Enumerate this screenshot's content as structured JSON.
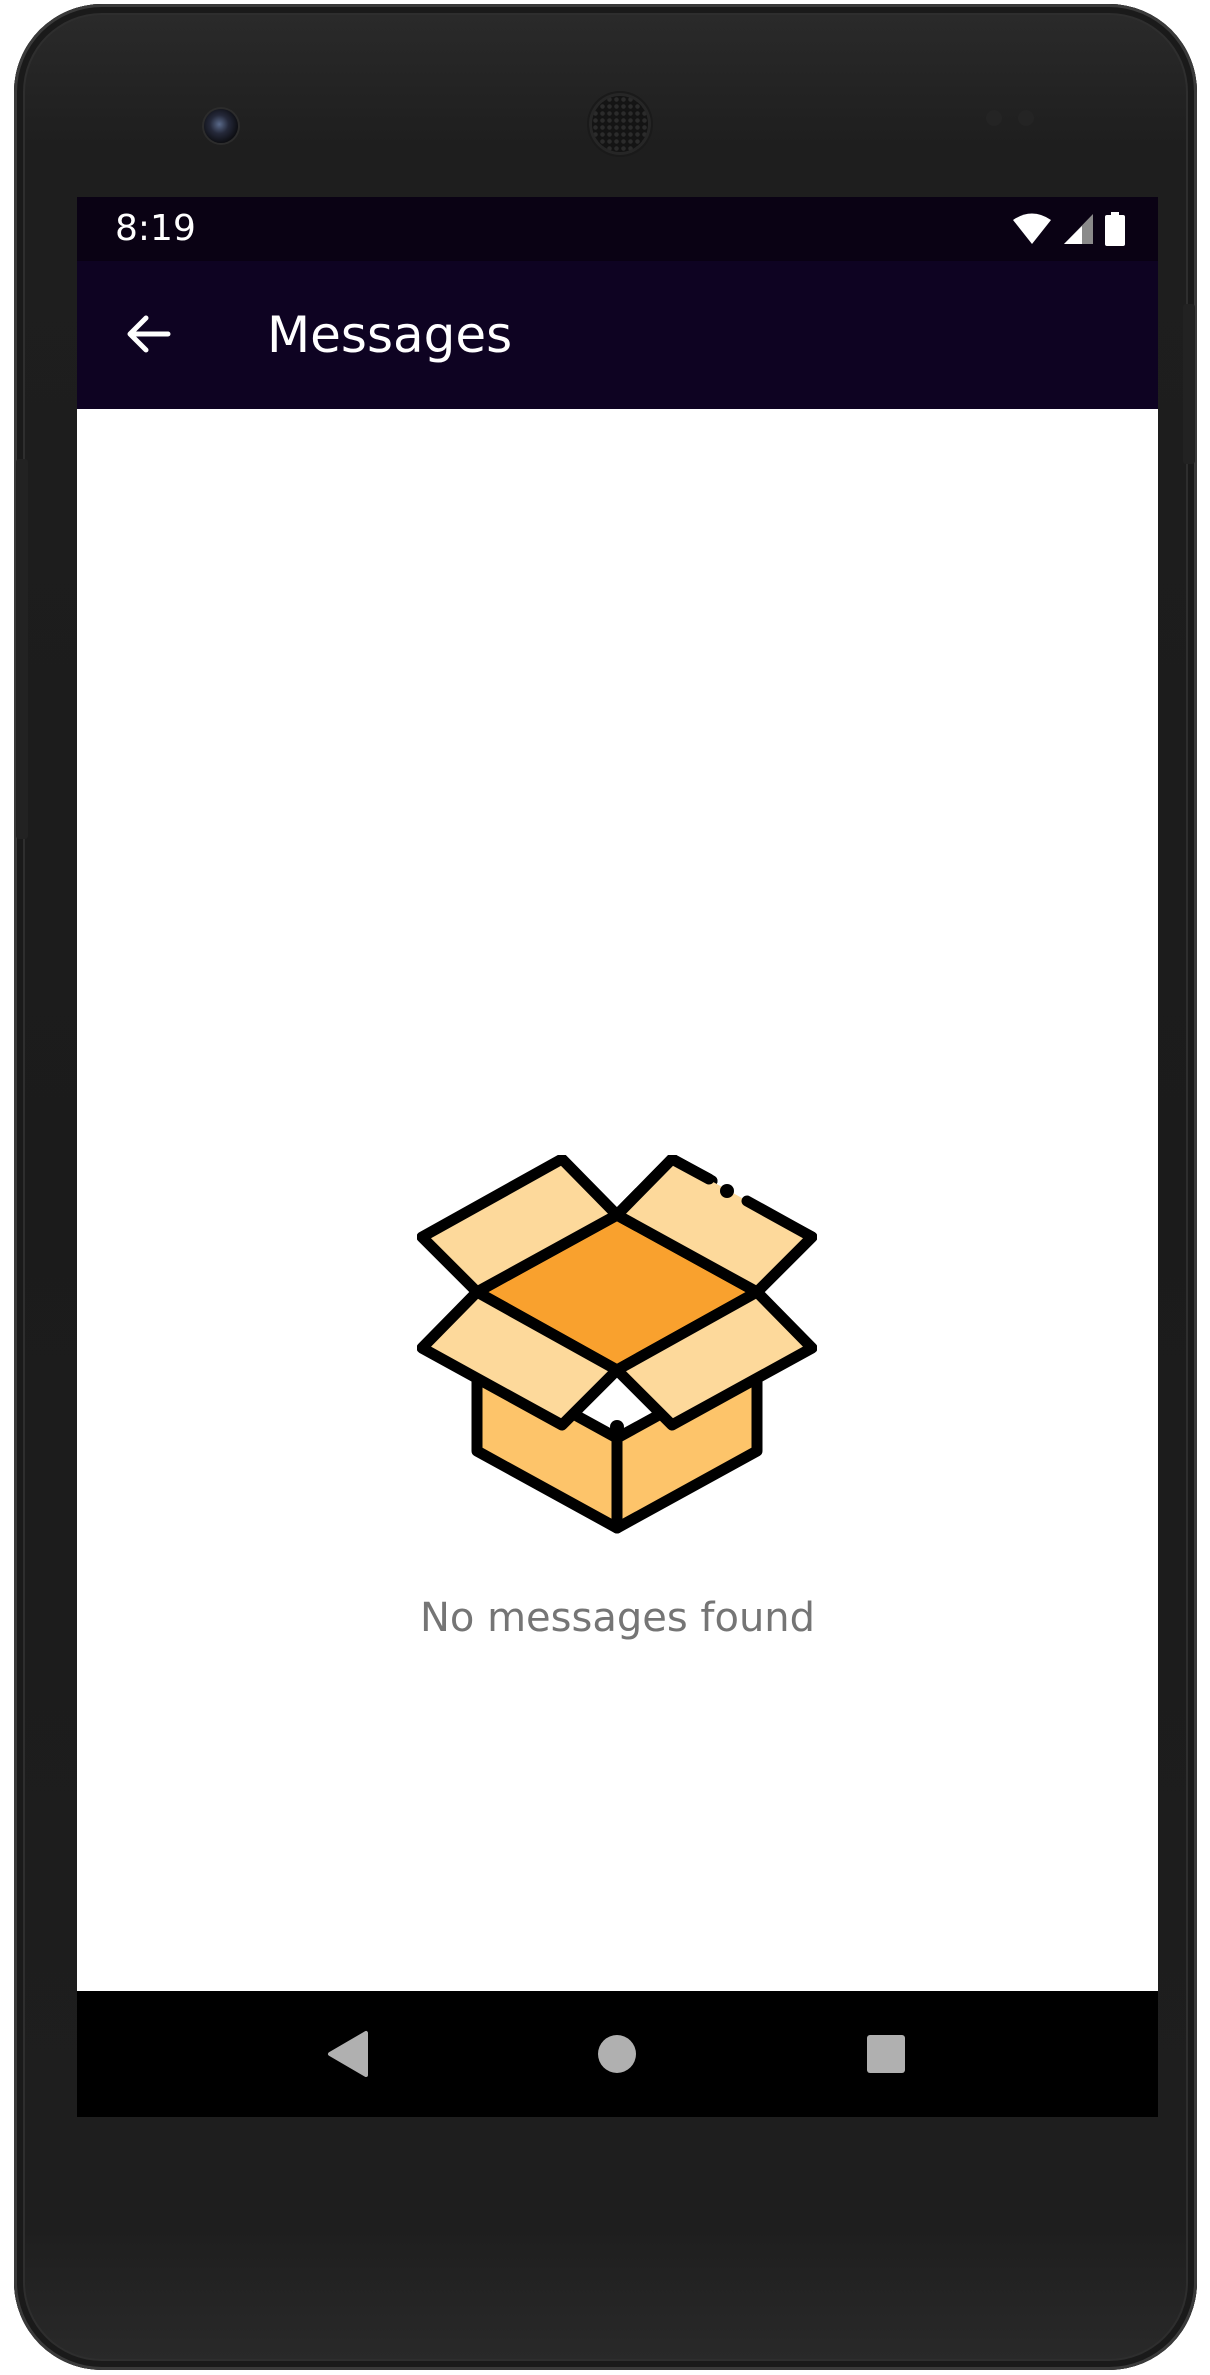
{
  "status_bar": {
    "time": "8:19",
    "icons": [
      "wifi-icon",
      "cell-signal-icon",
      "battery-icon"
    ]
  },
  "app_bar": {
    "title": "Messages",
    "back_icon": "arrow-back-icon",
    "background_color": "#0e0322"
  },
  "empty_state": {
    "icon": "open-box-icon",
    "message": "No messages found"
  },
  "nav_bar": {
    "buttons": [
      "back-triangle-icon",
      "home-circle-icon",
      "recents-square-icon"
    ]
  },
  "colors": {
    "status_bar": "#0a0214",
    "box_top": "#f9a12e",
    "box_flaps": "#fdd99b",
    "box_front": "#fdc46a",
    "empty_text": "#757575"
  }
}
